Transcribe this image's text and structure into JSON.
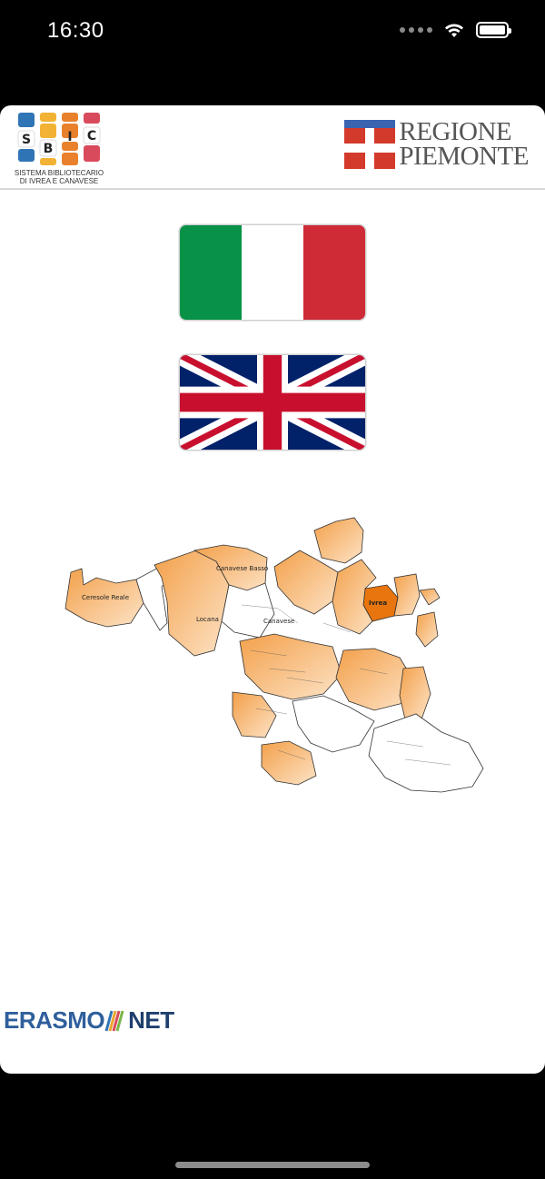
{
  "status_bar": {
    "time": "16:30"
  },
  "header": {
    "sbic": {
      "letters": [
        "S",
        "B",
        "I",
        "C"
      ],
      "caption_line1": "SISTEMA BIBLIOTECARIO",
      "caption_line2": "DI IVREA E CANAVESE"
    },
    "regione": {
      "line1": "REGIONE",
      "line2": "PIEMONTE"
    }
  },
  "languages": [
    {
      "name": "italiano",
      "flag": "italy-flag"
    },
    {
      "name": "english",
      "flag": "uk-flag"
    }
  ],
  "map": {
    "highlight_label": "Ivrea",
    "labels": [
      "Canavese Basso",
      "Canavese",
      "Ivrea",
      "Locana",
      "Ceresole Reale"
    ]
  },
  "footer": {
    "brand_part1": "ERASMO",
    "brand_part2": "NET"
  },
  "colors": {
    "orange": "#f3a04a",
    "orange_dark": "#e8750e",
    "green": "#089247",
    "red": "#ce2b37",
    "uk_blue": "#012169",
    "uk_red": "#c8102e"
  }
}
